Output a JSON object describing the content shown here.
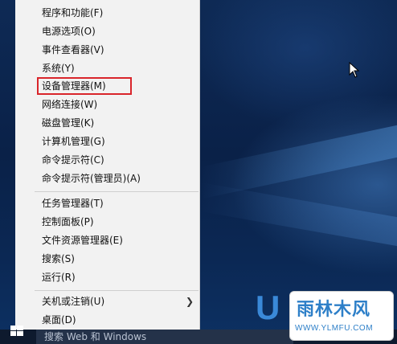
{
  "menu": {
    "items": [
      {
        "label": "程序和功能(F)"
      },
      {
        "label": "电源选项(O)"
      },
      {
        "label": "事件查看器(V)"
      },
      {
        "label": "系统(Y)"
      },
      {
        "label": "设备管理器(M)"
      },
      {
        "label": "网络连接(W)"
      },
      {
        "label": "磁盘管理(K)"
      },
      {
        "label": "计算机管理(G)"
      },
      {
        "label": "命令提示符(C)"
      },
      {
        "label": "命令提示符(管理员)(A)"
      },
      {
        "label": "任务管理器(T)"
      },
      {
        "label": "控制面板(P)"
      },
      {
        "label": "文件资源管理器(E)"
      },
      {
        "label": "搜索(S)"
      },
      {
        "label": "运行(R)"
      },
      {
        "label": "关机或注销(U)"
      },
      {
        "label": "桌面(D)"
      }
    ],
    "highlighted_item": "设备管理器(M)",
    "highlight_color": "#d9252b"
  },
  "taskbar": {
    "search_text": "搜索 Web 和 Windows"
  },
  "watermark": {
    "letter": "U",
    "title": "雨林木风",
    "url": "WWW.YLMFU.COM"
  },
  "colors": {
    "menu_bg": "#f2f2f2",
    "desktop_bg": "#0b1f3f",
    "watermark_blue": "#2d7fc8"
  }
}
